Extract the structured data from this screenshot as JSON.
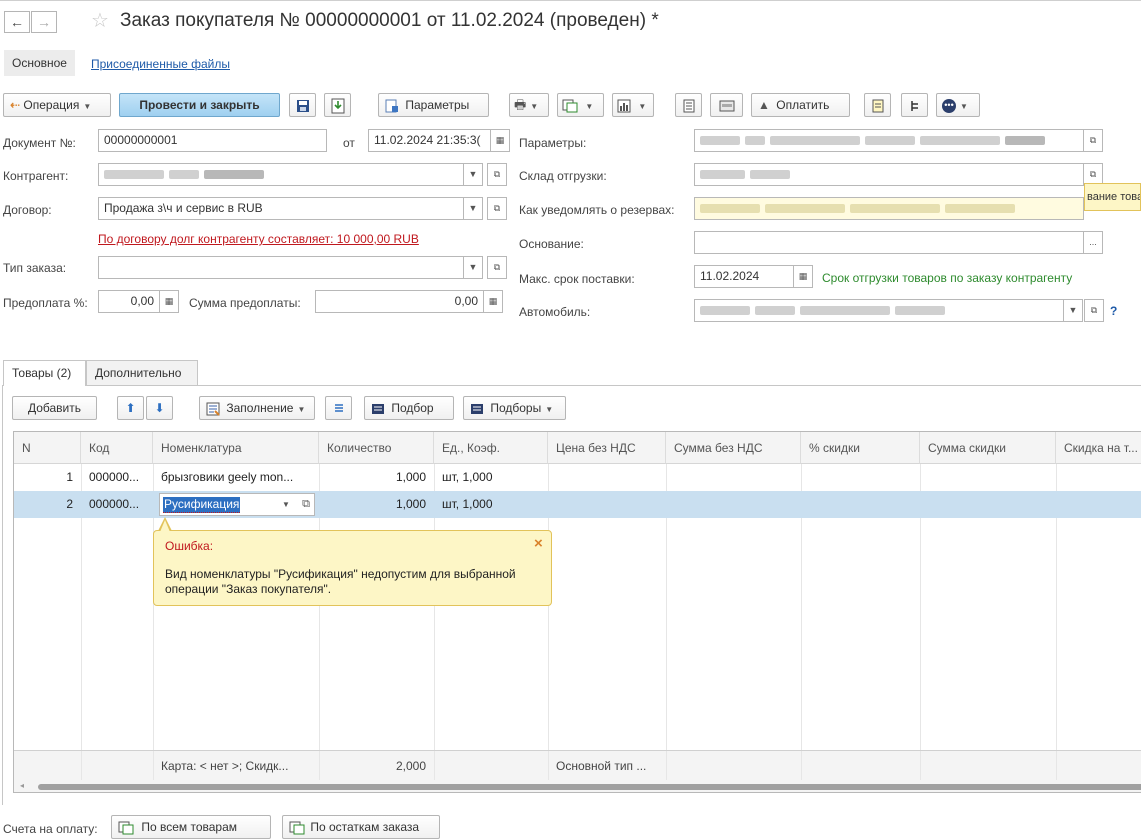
{
  "window": {
    "title": "Заказ покупателя № 00000000001 от 11.02.2024 (проведен) *"
  },
  "subsections": {
    "main": "Основное",
    "files": "Присоединенные файлы"
  },
  "toolbar": {
    "operation": "Операция",
    "post_close": "Провести и закрыть",
    "params": "Параметры",
    "pay": "Оплатить"
  },
  "form": {
    "doc_no_label": "Документ №:",
    "doc_no": "00000000001",
    "date_label": "от",
    "date": "11.02.2024 21:35:3(",
    "contractor_label": "Контрагент:",
    "contract_label": "Договор:",
    "contract": "Продажа з\\ч и сервис в RUB",
    "debt_link": "По договору долг контрагенту составляет: 10 000,00 RUB",
    "order_type_label": "Тип заказа:",
    "order_type": "",
    "prepay_pct_label": "Предоплата %:",
    "prepay_pct": "0,00",
    "prepay_sum_label": "Сумма предоплаты:",
    "prepay_sum": "0,00",
    "params_label": "Параметры:",
    "warehouse_label": "Склад отгрузки:",
    "notify_label": "Как уведомлять о резервах:",
    "notify_overflow": "вание това",
    "basis_label": "Основание:",
    "basis": "",
    "basis_btn": "...",
    "max_term_label": "Макс. срок поставки:",
    "max_term": "11.02.2024",
    "max_term_link": "Срок отгрузки товаров по заказу контрагенту",
    "car_label": "Автомобиль:",
    "help": "?"
  },
  "tabs": {
    "goods": "Товары (2)",
    "extra": "Дополнительно"
  },
  "grid_toolbar": {
    "add": "Добавить",
    "fill": "Заполнение",
    "pick": "Подбор",
    "picks": "Подборы"
  },
  "grid": {
    "columns": [
      "N",
      "Код",
      "Номенклатура",
      "Количество",
      "Ед., Коэф.",
      "Цена без НДС",
      "Сумма без НДС",
      "% скидки",
      "Сумма скидки",
      "Скидка на т..."
    ],
    "rows": [
      {
        "n": "1",
        "code": "000000...",
        "item": "брызговики geely mon...",
        "qty": "1,000",
        "unit": "шт, 1,000"
      },
      {
        "n": "2",
        "code": "000000...",
        "item": "Русификация",
        "qty": "1,000",
        "unit": "шт, 1,000"
      }
    ],
    "footer": {
      "card": "Карта: < нет >; Скидк...",
      "qty_total": "2,000",
      "price_type": "Основной тип ..."
    }
  },
  "error_tooltip": {
    "title": "Ошибка:",
    "close": "×",
    "message_line1": "Вид номенклатуры \"Русификация\" недопустим для выбранной",
    "message_line2": "операции \"Заказ покупателя\"."
  },
  "bottom": {
    "label": "Счета на оплату:",
    "btn_all": "По всем товарам",
    "btn_rest": "По остаткам заказа"
  },
  "colors": {
    "link": "#1e5aa8",
    "debt_link": "#c0181e",
    "green_link": "#2e8b2e",
    "primary_button": "#9fd0f0",
    "selected_row": "#c9dff0",
    "tooltip_bg": "#fdf6c6"
  }
}
